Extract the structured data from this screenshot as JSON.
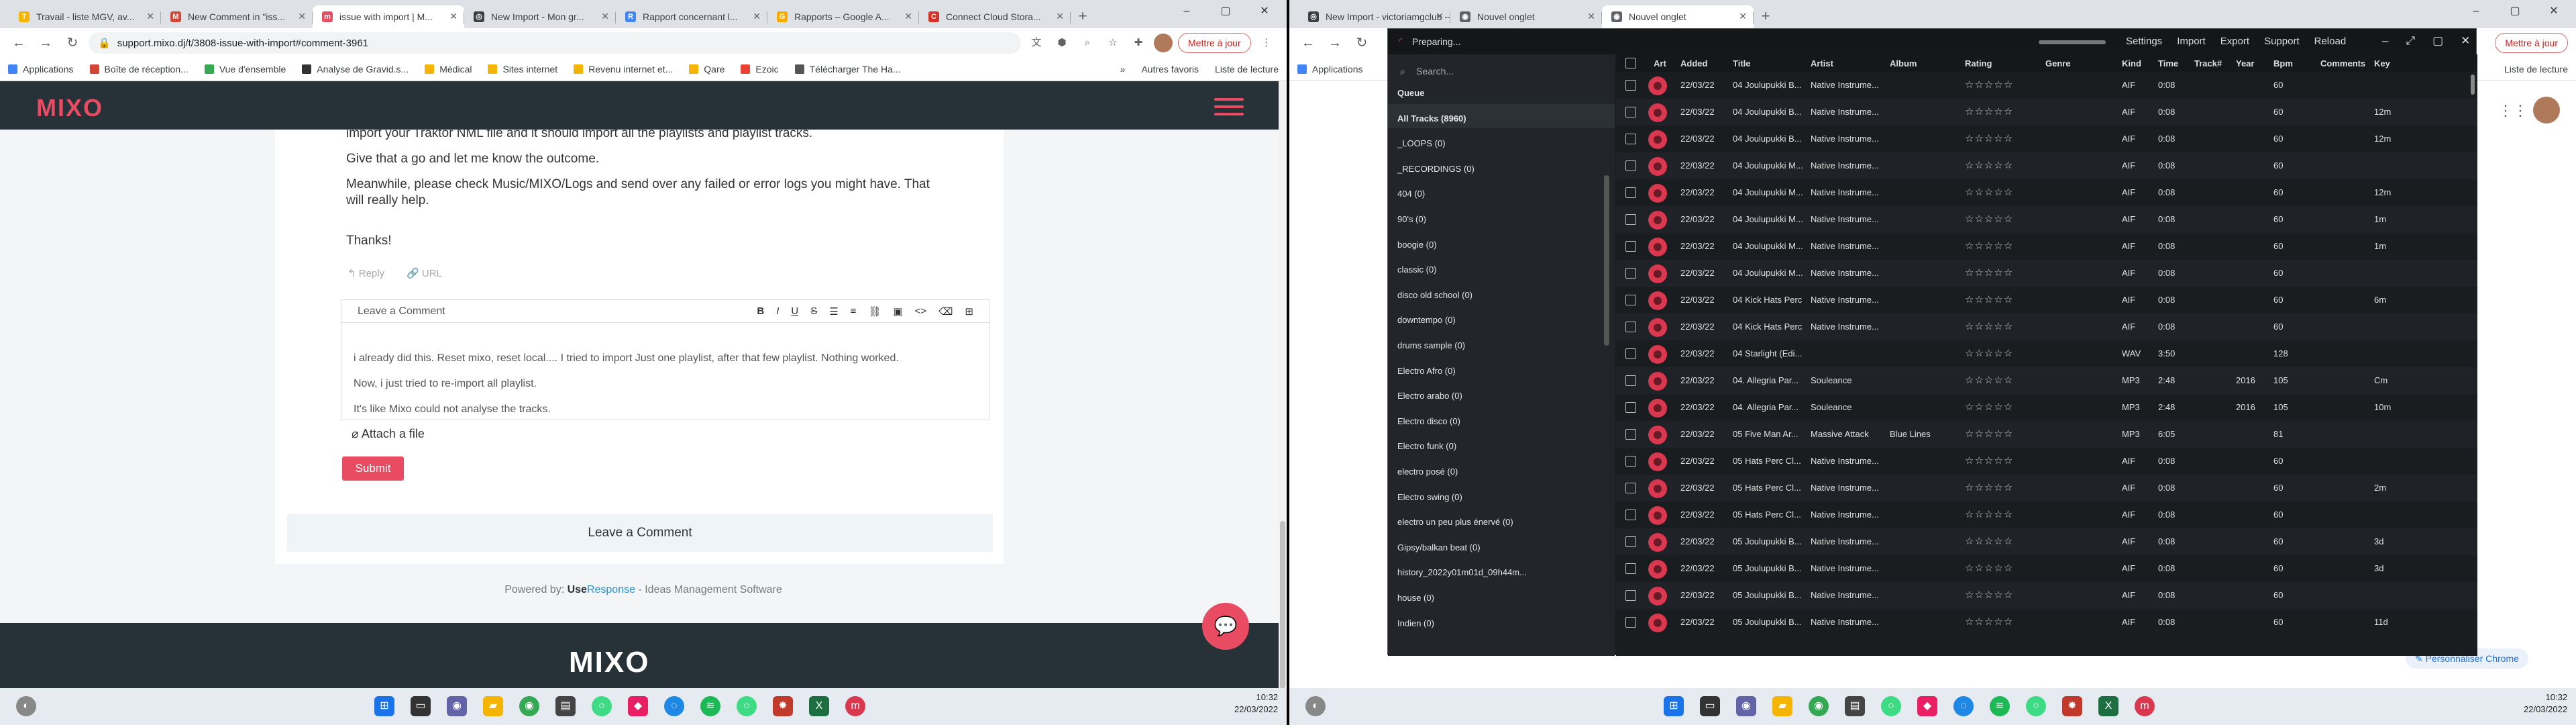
{
  "left": {
    "tabs": [
      {
        "title": "Travail - liste MGV, av...",
        "fav": "#f4b400",
        "glyph": "T"
      },
      {
        "title": "New Comment in \"iss...",
        "fav": "#d44638",
        "glyph": "M"
      },
      {
        "title": "issue with import | M...",
        "fav": "#e94b63",
        "glyph": "m",
        "active": true
      },
      {
        "title": "New Import - Mon gr...",
        "fav": "#3c4043",
        "glyph": "◎"
      },
      {
        "title": "Rapport concernant l...",
        "fav": "#4285f4",
        "glyph": "R"
      },
      {
        "title": "Rapports – Google A...",
        "fav": "#f9ab00",
        "glyph": "G"
      },
      {
        "title": "Connect Cloud Stora...",
        "fav": "#d93025",
        "glyph": "C"
      }
    ],
    "url": "support.mixo.dj/t/3808-issue-with-import#comment-3961",
    "update_label": "Mettre à jour",
    "bookmarks": [
      "Applications",
      "Boîte de réception...",
      "Vue d'ensemble",
      "Analyse de Gravid.s...",
      "Médical",
      "Sites internet",
      "Revenu internet et...",
      "Qare",
      "Ezoic",
      "Télécharger The Ha..."
    ],
    "bookmarks_right": [
      "»",
      "Autres favoris",
      "Liste de lecture"
    ],
    "logo": "MIXO",
    "para1": "import your Traktor NML file and it should import all the playlists and playlist tracks.",
    "para2": "Give that a go and let me know the outcome.",
    "para3a": "Meanwhile, please check Music/MIXO/Logs and send over any failed or error logs you might have. That",
    "para3b": "will really help.",
    "thanks": "Thanks!",
    "reply": "Reply",
    "url_link": "URL",
    "leave_comment_header": "Leave a Comment",
    "comment_lines": [
      "i already did this. Reset mixo, reset local.... I tried to import Just one playlist, after that few playlist. Nothing worked.",
      "Now, i just tried to re-import all playlist.",
      "It's like Mixo could not analyse the tracks."
    ],
    "attach": "Attach a file",
    "submit": "Submit",
    "leave_comment_bar": "Leave a Comment",
    "powered_prefix": "Powered by: ",
    "powered_use": "Use",
    "powered_response": "Response",
    "powered_suffix": " - Ideas Management Software",
    "footer_logo": "MIXO",
    "time": "10:32",
    "date": "22/03/2022"
  },
  "right": {
    "tabs": [
      {
        "title": "New Import - victoriamgclub -- ",
        "fav": "#3c4043",
        "glyph": "◎"
      },
      {
        "title": "Nouvel onglet",
        "fav": "#5f6368",
        "glyph": "◉"
      },
      {
        "title": "Nouvel onglet",
        "fav": "#5f6368",
        "glyph": "◉",
        "active": true
      }
    ],
    "update_label": "Mettre à jour",
    "bookmark": "Applications",
    "bookmark_right": "Liste de lecture",
    "personalize": "Personnaliser Chrome",
    "time": "10:32",
    "date": "22/03/2022"
  },
  "app": {
    "status": "Preparing...",
    "menu": [
      "Settings",
      "Import",
      "Export",
      "Support",
      "Reload"
    ],
    "search_placeholder": "Search...",
    "sidebar": [
      "Queue",
      "All Tracks (8960)",
      "_LOOPS (0)",
      "_RECORDINGS (0)",
      "404 (0)",
      "90's (0)",
      "boogie (0)",
      "classic (0)",
      "disco old school (0)",
      "downtempo (0)",
      "drums sample (0)",
      "Electro Afro (0)",
      "Electro arabo (0)",
      "Electro disco (0)",
      "Electro funk (0)",
      "electro posé (0)",
      "Electro swing (0)",
      "electro un peu plus énervé (0)",
      "Gipsy/balkan beat (0)",
      "history_2022y01m01d_09h44m...",
      "house (0)",
      "Indien (0)"
    ],
    "columns": [
      "Art",
      "Added",
      "Title",
      "Artist",
      "Album",
      "Rating",
      "Genre",
      "Kind",
      "Time",
      "Track#",
      "Year",
      "Bpm",
      "Comments",
      "Key"
    ],
    "rows": [
      [
        "22/03/22",
        "04 Joulupukki B...",
        "Native Instrume...",
        "",
        "AIF",
        "0:08",
        "",
        "60",
        ""
      ],
      [
        "22/03/22",
        "04 Joulupukki B...",
        "Native Instrume...",
        "",
        "AIF",
        "0:08",
        "",
        "60",
        "12m"
      ],
      [
        "22/03/22",
        "04 Joulupukki B...",
        "Native Instrume...",
        "",
        "AIF",
        "0:08",
        "",
        "60",
        "12m"
      ],
      [
        "22/03/22",
        "04 Joulupukki M...",
        "Native Instrume...",
        "",
        "AIF",
        "0:08",
        "",
        "60",
        ""
      ],
      [
        "22/03/22",
        "04 Joulupukki M...",
        "Native Instrume...",
        "",
        "AIF",
        "0:08",
        "",
        "60",
        "12m"
      ],
      [
        "22/03/22",
        "04 Joulupukki M...",
        "Native Instrume...",
        "",
        "AIF",
        "0:08",
        "",
        "60",
        "1m"
      ],
      [
        "22/03/22",
        "04 Joulupukki M...",
        "Native Instrume...",
        "",
        "AIF",
        "0:08",
        "",
        "60",
        "1m"
      ],
      [
        "22/03/22",
        "04 Joulupukki M...",
        "Native Instrume...",
        "",
        "AIF",
        "0:08",
        "",
        "60",
        ""
      ],
      [
        "22/03/22",
        "04 Kick Hats Perc",
        "Native Instrume...",
        "",
        "AIF",
        "0:08",
        "",
        "60",
        "6m"
      ],
      [
        "22/03/22",
        "04 Kick Hats Perc",
        "Native Instrume...",
        "",
        "AIF",
        "0:08",
        "",
        "60",
        ""
      ],
      [
        "22/03/22",
        "04 Starlight (Edi...",
        "",
        "",
        "WAV",
        "3:50",
        "",
        "128",
        ""
      ],
      [
        "22/03/22",
        "04. Allegria Par...",
        "Souleance",
        "",
        "MP3",
        "2:48",
        "2016",
        "105",
        "Cm"
      ],
      [
        "22/03/22",
        "04. Allegria Par...",
        "Souleance",
        "",
        "MP3",
        "2:48",
        "2016",
        "105",
        "10m"
      ],
      [
        "22/03/22",
        "05 Five Man Ar...",
        "Massive Attack",
        "Blue Lines",
        "MP3",
        "6:05",
        "",
        "81",
        ""
      ],
      [
        "22/03/22",
        "05 Hats Perc Cl...",
        "Native Instrume...",
        "",
        "AIF",
        "0:08",
        "",
        "60",
        ""
      ],
      [
        "22/03/22",
        "05 Hats Perc Cl...",
        "Native Instrume...",
        "",
        "AIF",
        "0:08",
        "",
        "60",
        "2m"
      ],
      [
        "22/03/22",
        "05 Hats Perc Cl...",
        "Native Instrume...",
        "",
        "AIF",
        "0:08",
        "",
        "60",
        ""
      ],
      [
        "22/03/22",
        "05 Joulupukki B...",
        "Native Instrume...",
        "",
        "AIF",
        "0:08",
        "",
        "60",
        "3d"
      ],
      [
        "22/03/22",
        "05 Joulupukki B...",
        "Native Instrume...",
        "",
        "AIF",
        "0:08",
        "",
        "60",
        "3d"
      ],
      [
        "22/03/22",
        "05 Joulupukki B...",
        "Native Instrume...",
        "",
        "AIF",
        "0:08",
        "",
        "60",
        ""
      ],
      [
        "22/03/22",
        "05 Joulupukki B...",
        "Native Instrume...",
        "",
        "AIF",
        "0:08",
        "",
        "60",
        "11d"
      ]
    ],
    "stars": "☆☆☆☆☆"
  },
  "colors": {
    "brand": "#e94b63",
    "dark": "#263238"
  }
}
